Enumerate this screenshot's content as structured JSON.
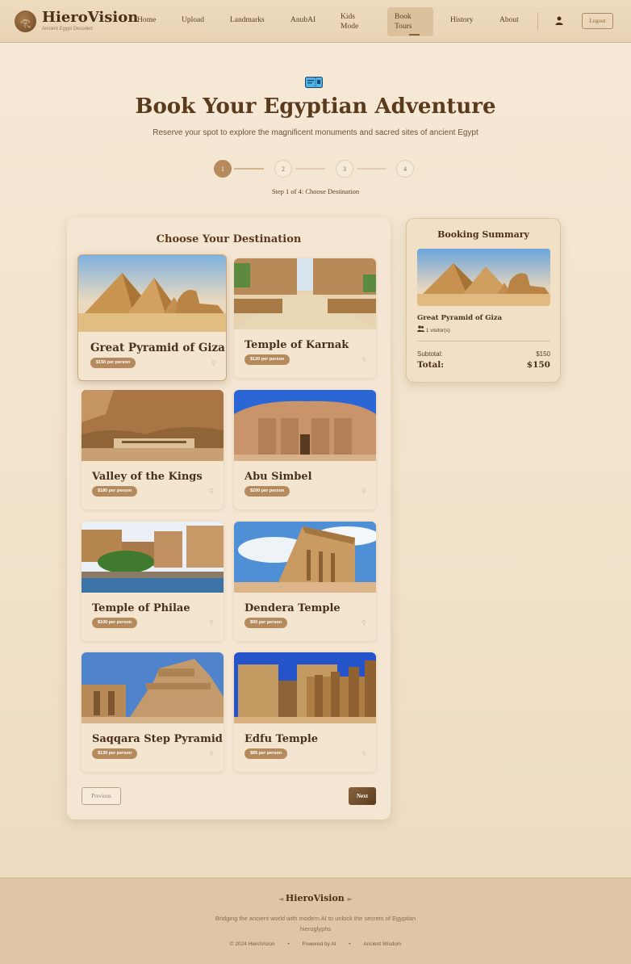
{
  "nav": {
    "brand": "HieroVision",
    "brand_sub": "Ancient Egypt Decoded",
    "links": [
      "Home",
      "Upload",
      "Landmarks",
      "AnubAI",
      "Kids Mode",
      "Book Tours",
      "History",
      "About"
    ],
    "logout_label": "Logout",
    "active_link": "Book Tours",
    "user_icon": "user-icon"
  },
  "hero": {
    "icon": "ticket-icon",
    "title": "Book Your Egyptian Adventure",
    "subtitle": "Reserve your spot to explore the magnificent monuments and sacred sites of ancient Egypt"
  },
  "stepper": {
    "steps": [
      "1",
      "2",
      "3",
      "4"
    ],
    "current": 1,
    "caption": "Step 1 of 4: Choose Destination"
  },
  "destinations": {
    "title": "Choose Your Destination",
    "selected": "Great Pyramid of Giza",
    "items": [
      {
        "name": "Great Pyramid of Giza",
        "price": "$150 per person"
      },
      {
        "name": "Temple of Karnak",
        "price": "$120 per person"
      },
      {
        "name": "Valley of the Kings",
        "price": "$180 per person"
      },
      {
        "name": "Abu Simbel",
        "price": "$200 per person"
      },
      {
        "name": "Temple of Philae",
        "price": "$100 per person"
      },
      {
        "name": "Dendera Temple",
        "price": "$90 per person"
      },
      {
        "name": "Saqqara Step Pyramid",
        "price": "$130 per person"
      },
      {
        "name": "Edfu Temple",
        "price": "$85 per person"
      }
    ],
    "prev_label": "Previous",
    "next_label": "Next"
  },
  "summary": {
    "title": "Booking Summary",
    "destination": "Great Pyramid of Giza",
    "visitors": "1 visitor(s)",
    "subtotal_label": "Subtotal:",
    "subtotal_value": "$150",
    "total_label": "Total:",
    "total_value": "$150"
  },
  "footer": {
    "brand": "HieroVision",
    "tagline": "Bridging the ancient world with modern AI to unlock the secrets of Egyptian hieroglyphs",
    "meta": [
      "© 2024 HieroVision",
      "•",
      "Powered by AI",
      "•",
      "Ancient Wisdom"
    ]
  },
  "colors": {
    "accent": "#b58a5c",
    "text_dark": "#4a3018",
    "background": "#f4e6d2"
  }
}
